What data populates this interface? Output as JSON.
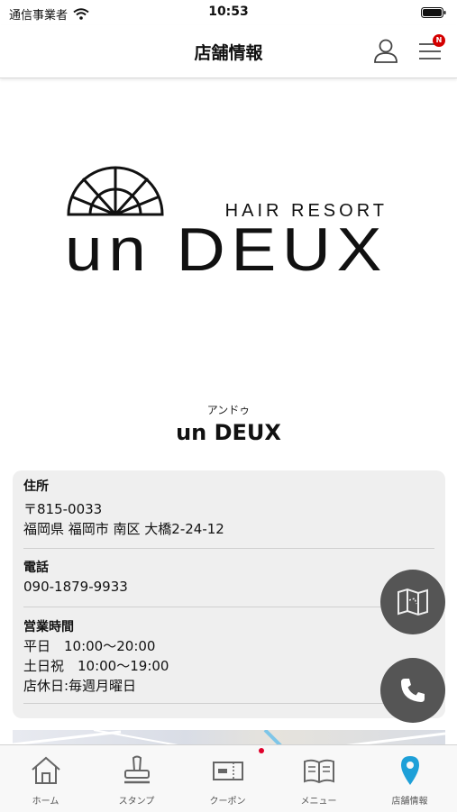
{
  "status": {
    "carrier": "通信事業者",
    "time": "10:53"
  },
  "nav": {
    "title": "店舗情報",
    "badge": "N",
    "icons": [
      "user-icon",
      "hamburger-menu-icon"
    ]
  },
  "logo": {
    "tagline": "HAIR RESORT",
    "brand": "un DEUX"
  },
  "shop": {
    "kana": "アンドゥ",
    "name": "un DEUX"
  },
  "info": {
    "address_label": "住所",
    "postal": "〒815-0033",
    "address": "福岡県 福岡市 南区 大橋2-24-12",
    "phone_label": "電話",
    "phone": "090-1879-9933",
    "hours_label": "営業時間",
    "hours_weekday": "平日　10:00〜20:00",
    "hours_weekend": "土日祝　10:00〜19:00",
    "holiday": "店休日:毎週月曜日"
  },
  "fabs": [
    "map-icon",
    "phone-icon"
  ],
  "tabs": [
    {
      "label": "ホーム",
      "icon": "home-icon"
    },
    {
      "label": "スタンプ",
      "icon": "stamp-icon"
    },
    {
      "label": "クーポン",
      "icon": "coupon-icon"
    },
    {
      "label": "メニュー",
      "icon": "book-icon"
    },
    {
      "label": "店舗情報",
      "icon": "location-pin-icon"
    }
  ],
  "colors": {
    "accent": "#1ea0d8",
    "badge": "#d40000",
    "fab": "#555555",
    "card": "#efefef"
  }
}
